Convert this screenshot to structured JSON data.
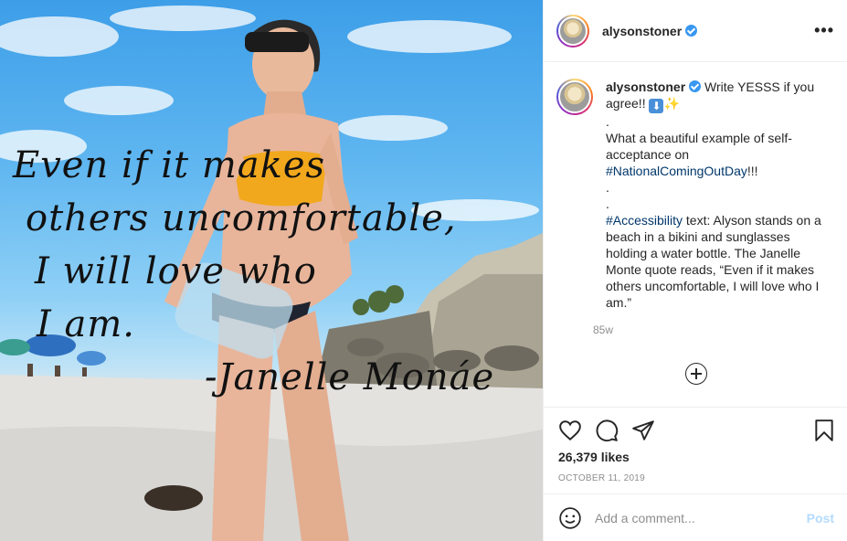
{
  "post": {
    "image": {
      "quote_lines": [
        "Even if it makes",
        "others uncomfortable,",
        "I will love who",
        "I am."
      ],
      "quote_author": "-Janelle Monáe"
    },
    "header": {
      "username": "alysonstoner",
      "verified": true,
      "more_label": "•••"
    },
    "caption": {
      "username": "alysonstoner",
      "line1": "Write YESSS if you agree!!",
      "emoji_arrow": "⬇",
      "emoji_sparkle": "✨",
      "dot": ".",
      "line2": "What a beautiful example of self-acceptance on",
      "hashtag1": "#NationalComingOutDay",
      "after_hashtag1": "!!!",
      "hashtag2": "#Accessibility",
      "accessibility_text": " text: Alyson stands on a beach in a bikini and sunglasses holding a water bottle. The Janelle Monte quote reads, “Even if it makes others uncomfortable, I will love who I am.”",
      "time_ago": "85w"
    },
    "likes": "26,379 likes",
    "date": "OCTOBER 11, 2019",
    "comment_box": {
      "placeholder": "Add a comment...",
      "post_label": "Post"
    }
  },
  "icons": {
    "like": "heart-icon",
    "comment": "comment-icon",
    "share": "paper-plane-icon",
    "save": "bookmark-icon",
    "emoji": "smiley-icon",
    "load_more": "plus-circle-icon"
  },
  "colors": {
    "link": "#00376b",
    "verified": "#3897f0",
    "post_button_disabled": "#b3dbff",
    "muted_text": "#8e8e8e"
  }
}
